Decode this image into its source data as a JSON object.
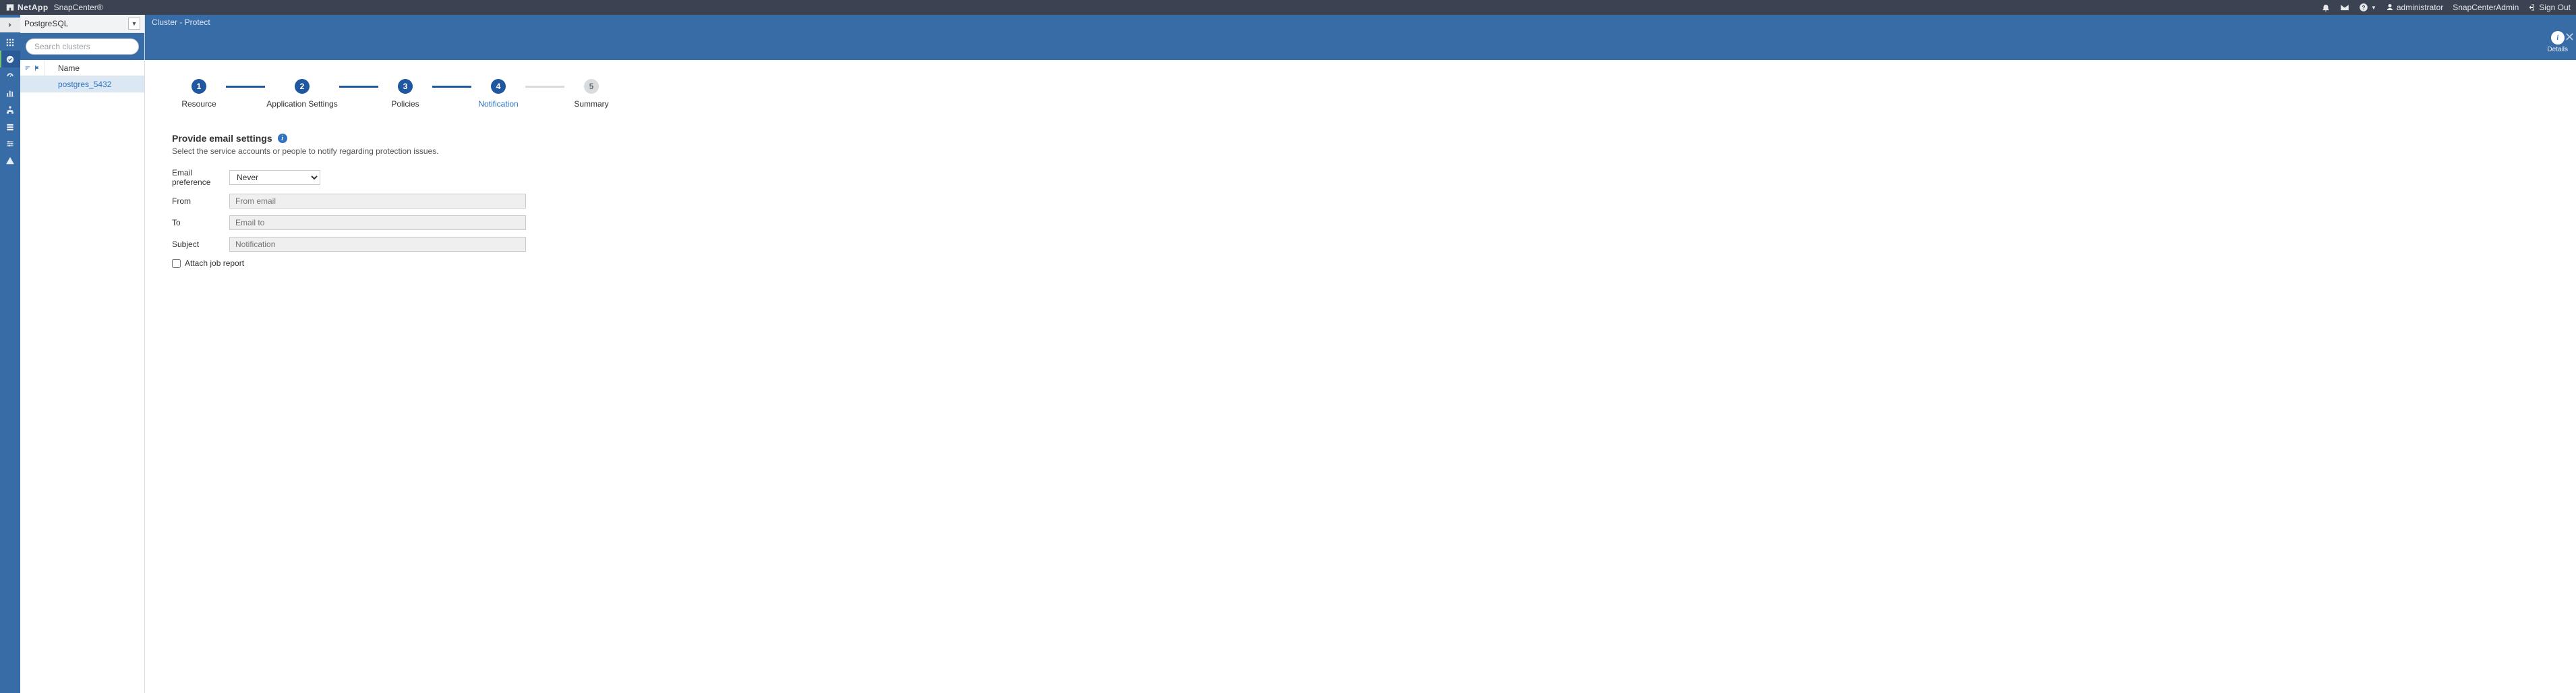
{
  "topbar": {
    "brand_bold": "NetApp",
    "brand_product": "SnapCenter®",
    "user": "administrator",
    "role": "SnapCenterAdmin",
    "signout": "Sign Out"
  },
  "sidebar": {
    "plugin_selected": "PostgreSQL",
    "search_placeholder": "Search clusters",
    "column_name": "Name",
    "rows": [
      {
        "name": "postgres_5432",
        "selected": true
      }
    ]
  },
  "breadcrumb": "Cluster - Protect",
  "details_label": "Details",
  "wizard": {
    "steps": [
      {
        "num": "1",
        "label": "Resource",
        "state": "done"
      },
      {
        "num": "2",
        "label": "Application Settings",
        "state": "done",
        "wide": true
      },
      {
        "num": "3",
        "label": "Policies",
        "state": "done"
      },
      {
        "num": "4",
        "label": "Notification",
        "state": "current"
      },
      {
        "num": "5",
        "label": "Summary",
        "state": "future"
      }
    ]
  },
  "form": {
    "heading": "Provide email settings",
    "subtext": "Select the service accounts or people to notify regarding protection issues.",
    "pref_label": "Email preference",
    "pref_value": "Never",
    "from_label": "From",
    "from_placeholder": "From email",
    "to_label": "To",
    "to_placeholder": "Email to",
    "subject_label": "Subject",
    "subject_placeholder": "Notification",
    "attach_label": "Attach job report"
  }
}
